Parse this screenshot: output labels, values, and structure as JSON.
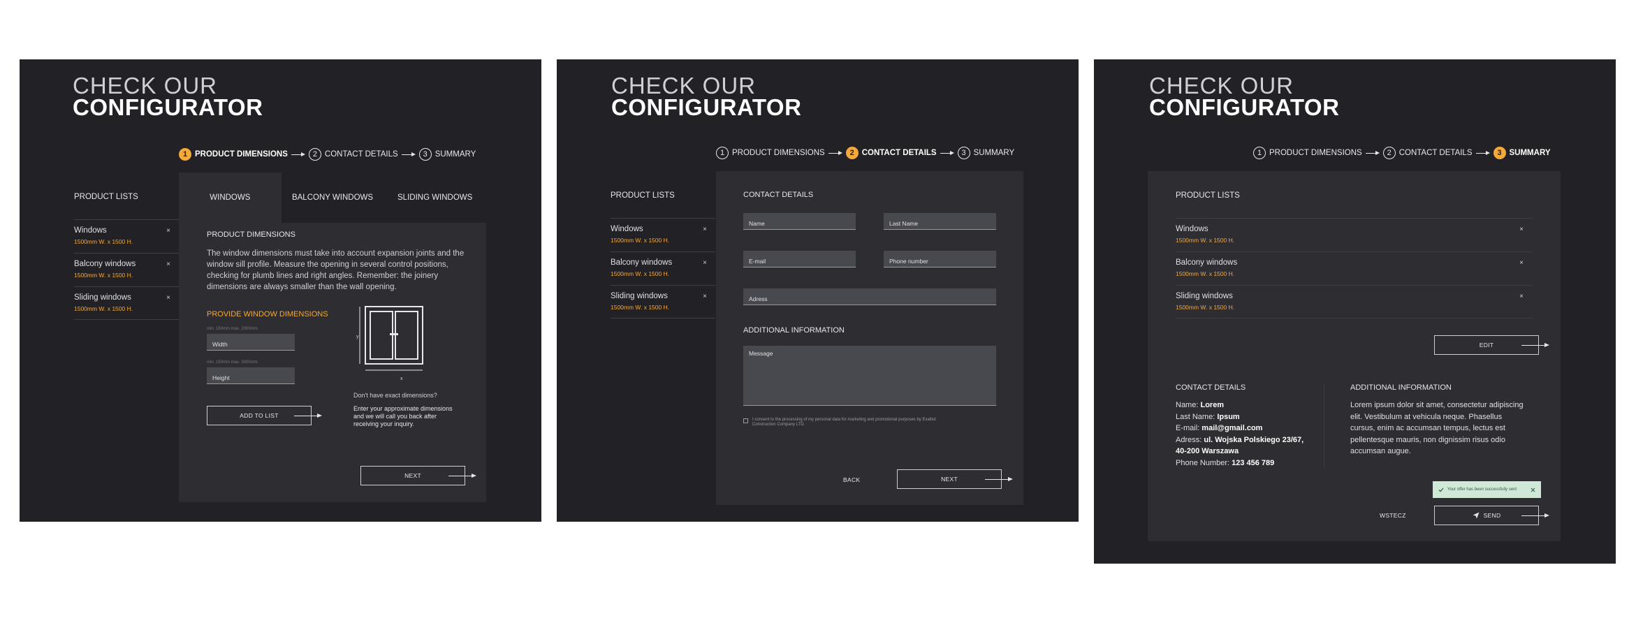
{
  "heading": {
    "light": "CHECK OUR",
    "bold": "CONFIGURATOR"
  },
  "steps": [
    "PRODUCT DIMENSIONS",
    "CONTACT DETAILS",
    "SUMMARY"
  ],
  "step_numbers": [
    "1",
    "2",
    "3"
  ],
  "product_lists_title": "PRODUCT LISTS",
  "products": [
    {
      "name": "Windows",
      "size": "1500mm W. x 1500 H."
    },
    {
      "name": "Balcony windows",
      "size": "1500mm W. x 1500 H."
    },
    {
      "name": "Sliding windows",
      "size": "1500mm W. x 1500 H."
    }
  ],
  "remove_glyph": "×",
  "screen1": {
    "tabs": [
      "WINDOWS",
      "BALCONY WINDOWS",
      "SLIDING WINDOWS"
    ],
    "section_title": "PRODUCT DIMENSIONS",
    "description": "The window dimensions must take into account expansion joints and the window sill profile. Measure the opening in several control positions, checking for plumb lines and right angles. Remember: the joinery dimensions are always smaller than the wall opening.",
    "provide_title": "PROVIDE WINDOW DIMENSIONS",
    "width_hint": "min. 150mm max. 2000mm",
    "width_placeholder": "Width",
    "height_hint": "min. 150mm max. 3000mm",
    "height_placeholder": "Height",
    "add_button": "ADD TO LIST",
    "axis_y": "y",
    "axis_x": "x",
    "no_dims_title": "Don't have exact dimensions?",
    "no_dims_text": "Enter your approximate dimensions and we will call you back after receiving your inquiry.",
    "next_button": "NEXT"
  },
  "screen2": {
    "section_title": "CONTACT DETAILS",
    "fields": {
      "name": "Name",
      "last_name": "Last Name",
      "email": "E-mail",
      "phone": "Phone number",
      "address": "Adress"
    },
    "additional_title": "ADDITIONAL INFORMATION",
    "message_placeholder": "Message",
    "consent": "I consent to the processing of my personal data for marketing and promotional purposes by Exaltist Construction Company LTD.",
    "back_button": "BACK",
    "next_button": "NEXT"
  },
  "screen3": {
    "edit_button": "EDIT",
    "contact_title": "CONTACT DETAILS",
    "contact": {
      "name_label": "Name:",
      "name_value": "Lorem",
      "last_label": "Last Name:",
      "last_value": "Ipsum",
      "email_label": "E-mail:",
      "email_value": "mail@gmail.com",
      "address_label": "Adress:",
      "address_value": "ul. Wojska Polskiego 23/67, 40-200 Warszawa",
      "phone_label": "Phone Number:",
      "phone_value": "123 456 789"
    },
    "additional_title": "ADDITIONAL INFORMATION",
    "additional_text": "Lorem ipsum dolor sit amet, consectetur adipiscing elit. Vestibulum at vehicula neque. Phasellus cursus, enim ac accumsan tempus, lectus est pellentesque mauris, non dignissim risus odio accumsan augue.",
    "toast": "Your offer has been successfully sent",
    "back_button": "WSTECZ",
    "send_button": "SEND"
  },
  "colors": {
    "accent": "#f5a93a",
    "panel": "#222226",
    "card": "#2d2d32",
    "toast_bg": "#cfe8d8"
  }
}
